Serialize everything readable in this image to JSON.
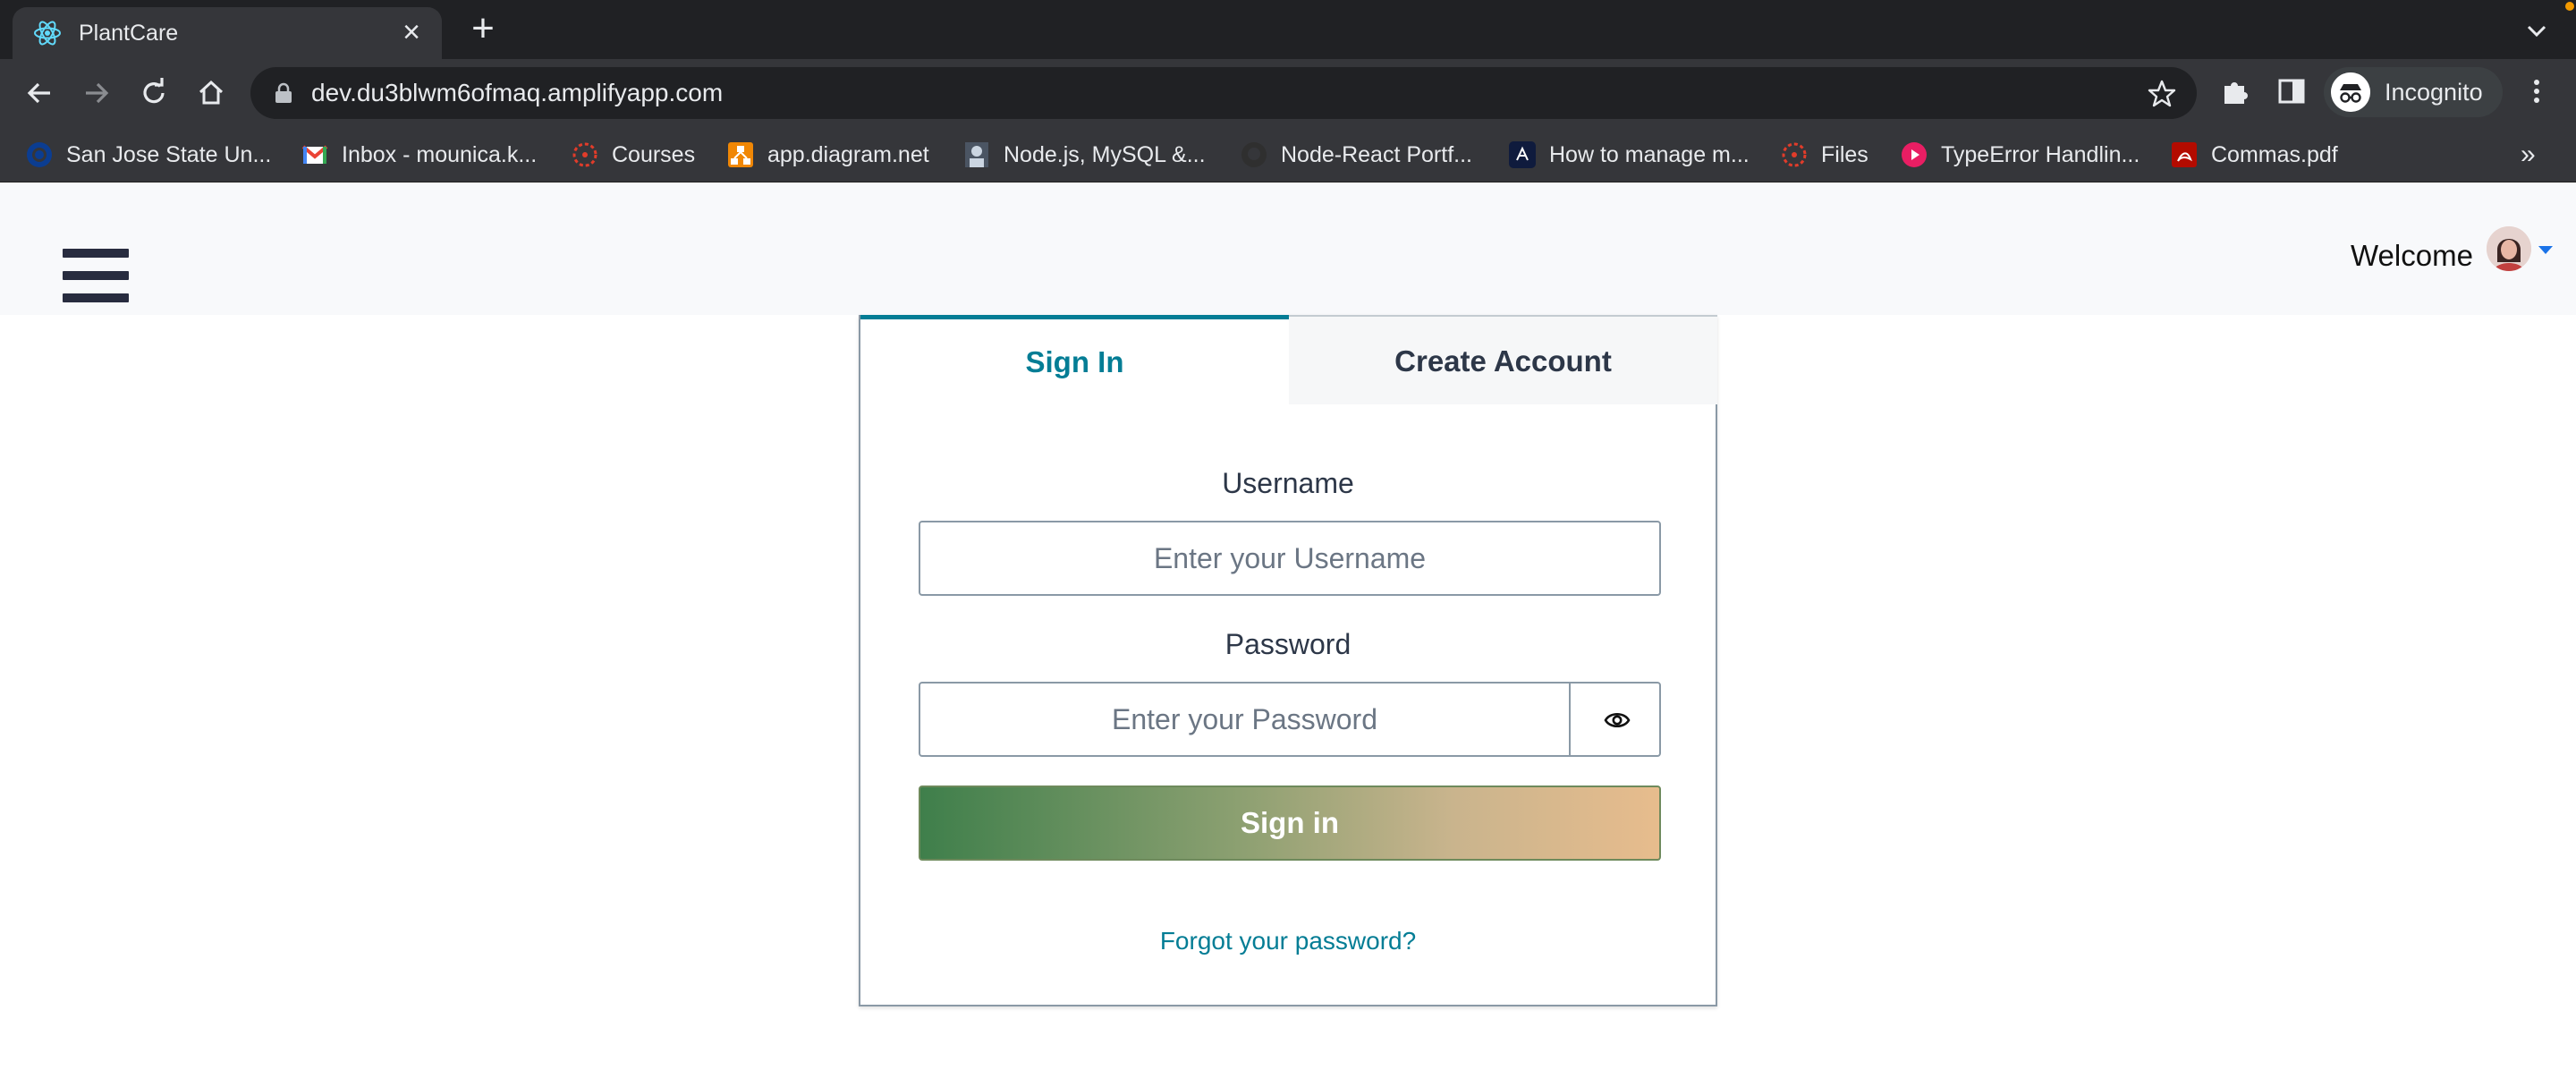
{
  "browser": {
    "tab": {
      "title": "PlantCare",
      "close_symbol": "×"
    },
    "new_tab_symbol": "+",
    "url": "dev.du3blwm6ofmaq.amplifyapp.com",
    "profile_label": "Incognito",
    "bookmarks": [
      {
        "label": "San Jose State Un...",
        "icon": "sjsu-icon",
        "color": "#0b3d91"
      },
      {
        "label": "Inbox - mounica.k...",
        "icon": "gmail-icon",
        "color": "#ea4335"
      },
      {
        "label": "Courses",
        "icon": "canvas-icon",
        "color": "#e13c2a"
      },
      {
        "label": "app.diagram.net",
        "icon": "drawio-icon",
        "color": "#f08705"
      },
      {
        "label": "Node.js, MySQL &...",
        "icon": "avatar-thumb-icon",
        "color": "#6b7280"
      },
      {
        "label": "Node-React Portf...",
        "icon": "github-icon",
        "color": "#2f2f2f"
      },
      {
        "label": "How to manage m...",
        "icon": "amplify-icon",
        "color": "#0f1b3d"
      },
      {
        "label": "Files",
        "icon": "canvas-icon",
        "color": "#e13c2a"
      },
      {
        "label": "TypeError Handlin...",
        "icon": "play-circle-icon",
        "color": "#e91e63"
      },
      {
        "label": "Commas.pdf",
        "icon": "pdf-icon",
        "color": "#b30b00"
      }
    ],
    "bookmarks_more": "»"
  },
  "header": {
    "welcome": "Welcome"
  },
  "auth": {
    "tabs": {
      "signin": "Sign In",
      "create": "Create Account"
    },
    "username": {
      "label": "Username",
      "placeholder": "Enter your Username"
    },
    "password": {
      "label": "Password",
      "placeholder": "Enter your Password"
    },
    "submit_label": "Sign in",
    "forgot_label": "Forgot your password?"
  },
  "colors": {
    "accent": "#047d95",
    "chrome_dark": "#202124",
    "chrome_toolbar": "#35363a"
  }
}
